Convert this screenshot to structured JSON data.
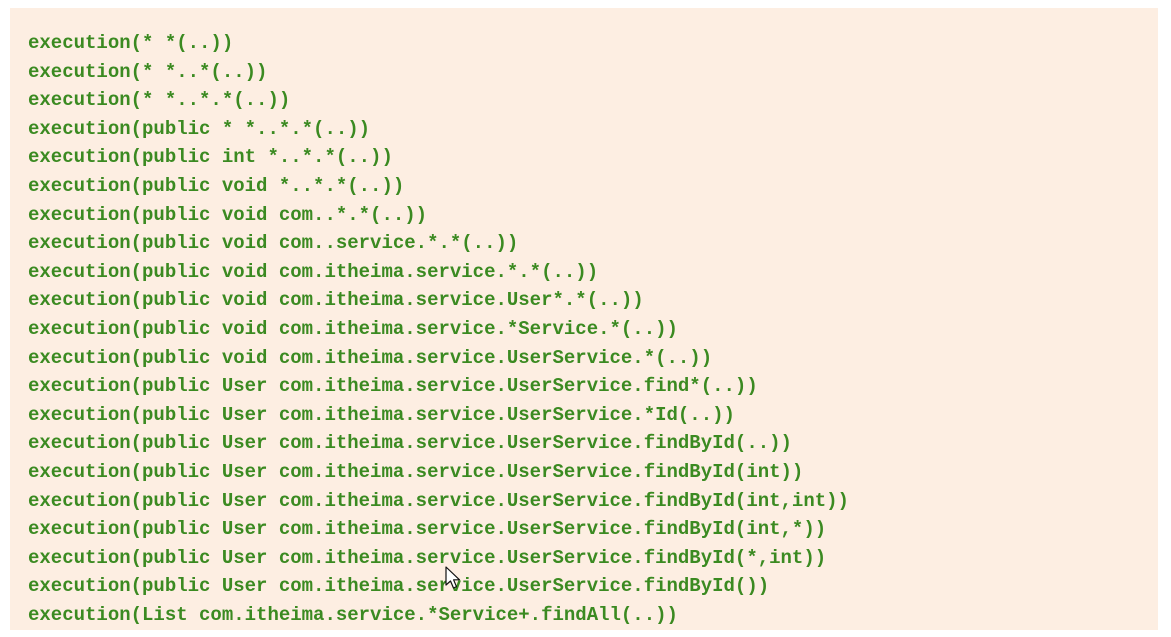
{
  "code": {
    "lines": [
      "execution(* *(..))",
      "execution(* *..*(..))",
      "execution(* *..*.*(..))",
      "execution(public * *..*.*(..))",
      "execution(public int *..*.*(..))",
      "execution(public void *..*.*(..))",
      "execution(public void com..*.*(..))",
      "execution(public void com..service.*.*(..))",
      "execution(public void com.itheima.service.*.*(..))",
      "execution(public void com.itheima.service.User*.*(..))",
      "execution(public void com.itheima.service.*Service.*(..))",
      "execution(public void com.itheima.service.UserService.*(..))",
      "execution(public User com.itheima.service.UserService.find*(..))",
      "execution(public User com.itheima.service.UserService.*Id(..))",
      "execution(public User com.itheima.service.UserService.findById(..))",
      "execution(public User com.itheima.service.UserService.findById(int))",
      "execution(public User com.itheima.service.UserService.findById(int,int))",
      "execution(public User com.itheima.service.UserService.findById(int,*))",
      "execution(public User com.itheima.service.UserService.findById(*,int))",
      "execution(public User com.itheima.service.UserService.findById())",
      "execution(List com.itheima.service.*Service+.findAll(..))"
    ]
  },
  "colors": {
    "panel_background": "#fdeee2",
    "code_text": "#3b8a21"
  },
  "icons": {
    "pointer": "mouse-pointer-icon"
  }
}
